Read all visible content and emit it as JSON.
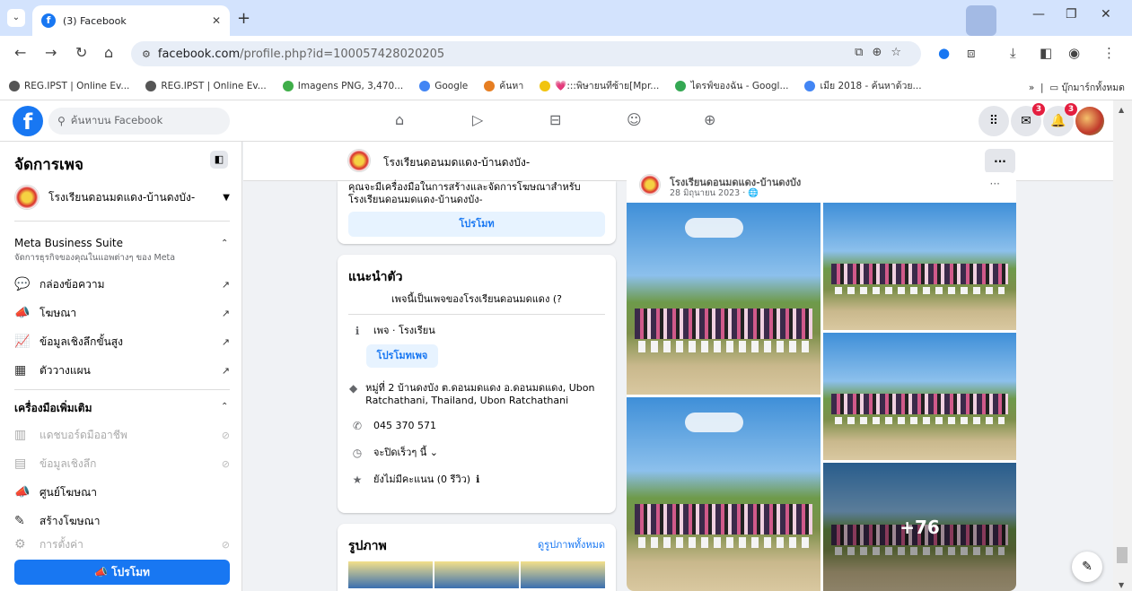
{
  "browser": {
    "tab_title": "(3) Facebook",
    "url_domain": "facebook.com",
    "url_path": "/profile.php?id=100057428020205",
    "bookmarks": [
      {
        "label": "REG.IPST | Online Ev...",
        "color": "#555555"
      },
      {
        "label": "REG.IPST | Online Ev...",
        "color": "#555555"
      },
      {
        "label": "Imagens PNG, 3,470...",
        "color": "#3fae49"
      },
      {
        "label": "Google",
        "color": "#4285f4"
      },
      {
        "label": "ค้นหา",
        "color": "#e67e22"
      },
      {
        "label": "💗:::พิษายนทีซ้าย[Mpr...",
        "color": "#f1c40f"
      },
      {
        "label": "ไดรฟ์ของฉัน - Googl...",
        "color": "#34a853"
      },
      {
        "label": "เมีย 2018 - ค้นหาด้วย...",
        "color": "#4285f4"
      }
    ],
    "bookmarks_more": "»",
    "all_bookmarks": "บุ๊กมาร์กทั้งหมด"
  },
  "facebook": {
    "search_placeholder": "ค้นหาบน Facebook",
    "messenger_count": "3",
    "notif_count": "3"
  },
  "sidebar": {
    "title": "จัดการเพจ",
    "page_name": "โรงเรียนดอนมดแดง-บ้านดงบัง-",
    "meta_title": "Meta Business Suite",
    "meta_sub": "จัดการธุรกิจของคุณในแอพต่างๆ ของ Meta",
    "meta_items": [
      {
        "label": "กล่องข้อความ",
        "icon": "💬"
      },
      {
        "label": "โฆษณา",
        "icon": "📣"
      },
      {
        "label": "ข้อมูลเชิงลึกขั้นสูง",
        "icon": "📈"
      },
      {
        "label": "ตัววางแผน",
        "icon": "▦"
      }
    ],
    "tools_title": "เครื่องมือเพิ่มเติม",
    "tools_items": [
      {
        "label": "แดชบอร์ดมืออาชีพ",
        "icon": "▥",
        "disabled": true
      },
      {
        "label": "ข้อมูลเชิงลึก",
        "icon": "▤",
        "disabled": true
      },
      {
        "label": "ศูนย์โฆษณา",
        "icon": "📣",
        "disabled": false
      },
      {
        "label": "สร้างโฆษณา",
        "icon": "✎",
        "disabled": false
      },
      {
        "label": "การตั้งค่า",
        "icon": "⚙",
        "disabled": true
      }
    ],
    "promote_btn": "โปรโมท"
  },
  "page_header": {
    "name": "โรงเรียนดอนมดแดง-บ้านดงบัง-",
    "more": "···"
  },
  "promo_card": {
    "text": "คุณจะมีเครื่องมือในการสร้างและจัดการโฆษณาสำหรับ โรงเรียนดอนมดแดง-บ้านดงบัง-",
    "button": "โปรโมท"
  },
  "intro": {
    "title": "แนะนำตัว",
    "desc": "เพจนี้เป็นเพจของโรงเรียนดอนมดแดง (?",
    "category": "เพจ · โรงเรียน",
    "promote_page": "โปรโมทเพจ",
    "address": "หมู่ที่ 2 บ้านดงบัง ต.ดอนมดแดง อ.ดอนมดแดง, Ubon Ratchathani, Thailand, Ubon Ratchathani",
    "phone": "045 370 571",
    "hours": "จะปิดเร็วๆ นี้ ⌄",
    "rating": "ยังไม่มีคะแนน (0 รีวิว)"
  },
  "photos": {
    "title": "รูปภาพ",
    "see_all": "ดูรูปภาพทั้งหมด"
  },
  "post": {
    "author": "โรงเรียนดอนมดแดง-บ้านดงบัง",
    "date": "28 มิถุนายน 2023 · 🌐",
    "more": "···",
    "extra_photos": "+76"
  }
}
